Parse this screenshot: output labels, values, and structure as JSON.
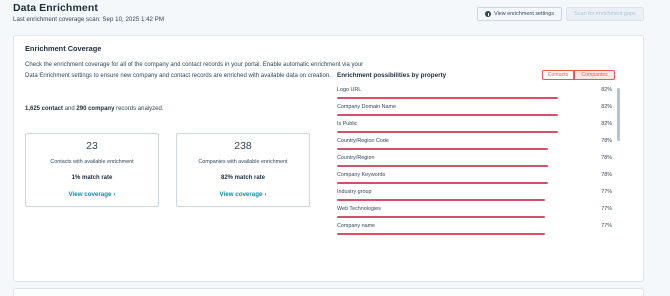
{
  "header": {
    "title": "Data Enrichment",
    "last_scan": "Last enrichment coverage scan: Sep 10, 2025 1:42 PM",
    "view_settings_label": "View enrichment settings",
    "scan_gaps_label": "Scan for enrichment gaps"
  },
  "coverage": {
    "title": "Enrichment Coverage",
    "description": "Check the enrichment coverage for all of the company and contact records in your portal. Enable automatic enrichment via your Data Enrichment settings to ensure new company and contact records are enriched with available data on creation.",
    "analyzed": {
      "contact_count": "1,625 contact",
      "and": "and",
      "company_count": "290 company",
      "suffix": "records analyzed."
    },
    "stats": [
      {
        "number": "23",
        "label": "Contacts with available enrichment",
        "match_rate": "1% match rate",
        "link": "View coverage"
      },
      {
        "number": "238",
        "label": "Companies with available enrichment",
        "match_rate": "82% match rate",
        "link": "View coverage"
      }
    ]
  },
  "chart_panel": {
    "title": "Enrichment possibilities by property",
    "toggle_contacts": "Contacts",
    "toggle_companies": "Companies"
  },
  "chart_data": {
    "type": "bar",
    "orientation": "horizontal",
    "title": "Enrichment possibilities by property",
    "selected_series": "Companies",
    "bar_color": "#d4506b",
    "xlim": [
      0,
      100
    ],
    "categories": [
      "Logo URL",
      "Company Domain Name",
      "Is Public",
      "Country/Region Code",
      "Country/Region",
      "Company Keywords",
      "Industry group",
      "Web Technologies",
      "Company name"
    ],
    "values": [
      82,
      82,
      82,
      78,
      78,
      78,
      77,
      77,
      77
    ],
    "value_labels": [
      "82%",
      "82%",
      "82%",
      "78%",
      "78%",
      "78%",
      "77%",
      "77%",
      "77%"
    ]
  },
  "colors": {
    "accent_link": "#0091ae",
    "toggle_accent": "#f2545b",
    "bar": "#d4506b"
  }
}
